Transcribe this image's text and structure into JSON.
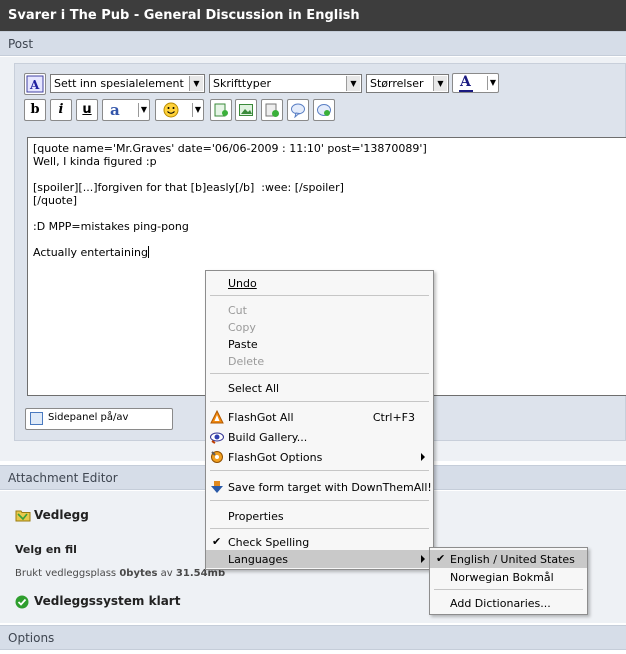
{
  "title": "Svarer i The Pub - General Discussion in English",
  "sections": {
    "post": "Post",
    "attachment_editor": "Attachment Editor",
    "options": "Options"
  },
  "toolbar": {
    "special_element": "Sett inn spesialelement",
    "font": "Skrifttyper",
    "size": "Størrelser",
    "font_color_glyph": "A",
    "bold": "b",
    "italic": "i",
    "underline": "u",
    "font_style_glyph": "a"
  },
  "editor": {
    "lines": [
      "[quote name='Mr.Graves' date='06/06-2009 : 11:10' post='13870089']",
      "Well, I kinda figured :p",
      "",
      "[spoiler][...]forgiven for that [b]easly[/b]  :wee: [/spoiler]",
      "[/quote]",
      "",
      ":D MPP=mistakes ping-pong",
      "",
      "Actually entertaining"
    ]
  },
  "sidepanel_toggle": "Sidepanel på/av",
  "attachments": {
    "heading": "Vedlegg",
    "choose_file": "Velg en fil",
    "usage_prefix": "Brukt vedleggsplass",
    "usage_used": "0bytes",
    "usage_of": "av",
    "usage_total": "31.54mb",
    "status": "Vedleggssystem klart"
  },
  "context_menu": {
    "undo": "Undo",
    "cut": "Cut",
    "copy": "Copy",
    "paste": "Paste",
    "delete": "Delete",
    "select_all": "Select All",
    "flashgot_all": "FlashGot All",
    "flashgot_all_shortcut": "Ctrl+F3",
    "build_gallery": "Build Gallery...",
    "flashgot_options": "FlashGot Options",
    "save_form_target": "Save form target with DownThemAll!",
    "properties": "Properties",
    "check_spelling": "Check Spelling",
    "languages": "Languages"
  },
  "languages_submenu": {
    "english_us": "English / United States",
    "norwegian": "Norwegian Bokmål",
    "add_dictionaries": "Add Dictionaries..."
  },
  "colors": {
    "titlebar": "#3d3d3d",
    "section_header": "#d6dde8",
    "section_body": "#eef1f5",
    "menu_highlight": "#c9c9c9",
    "status_green": "#2e9e2e"
  }
}
